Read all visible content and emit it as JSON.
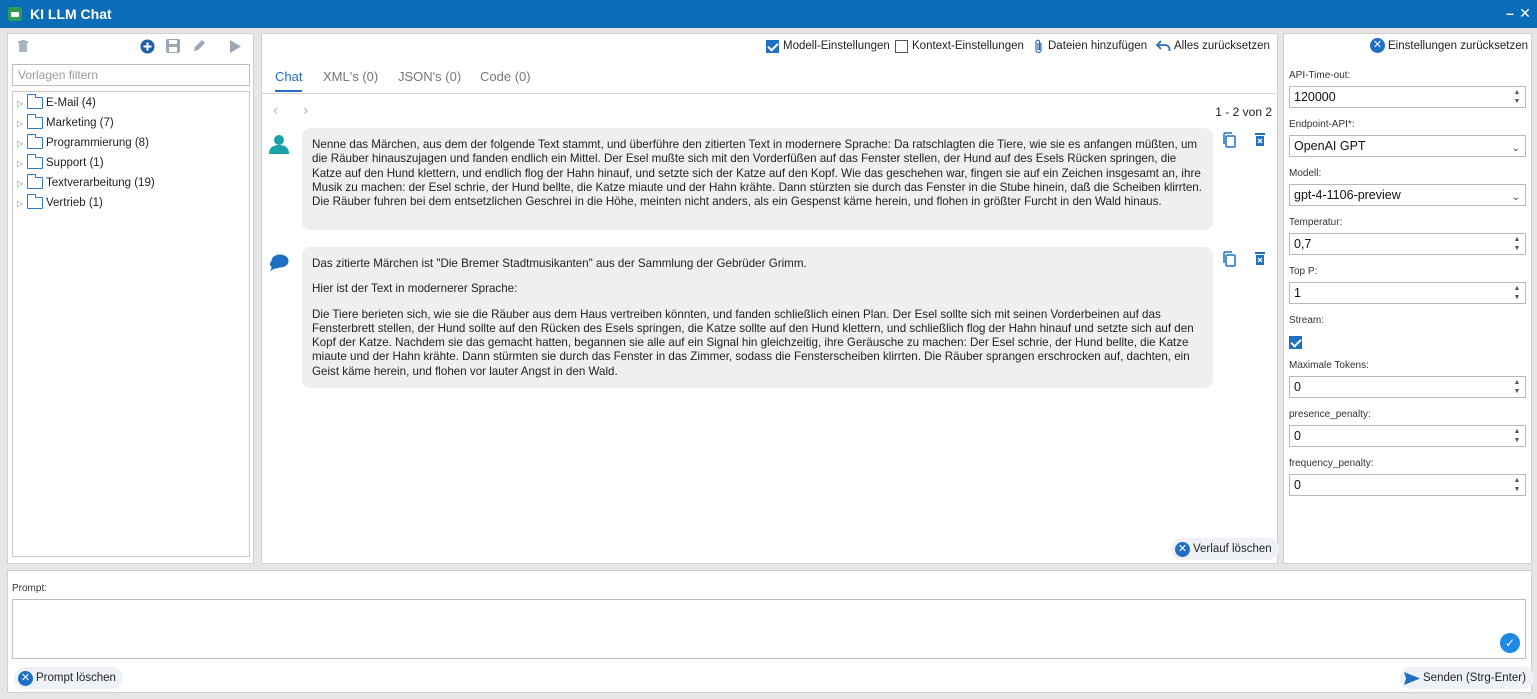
{
  "app": {
    "title": "KI LLM Chat",
    "minimize": "–",
    "close": "✕"
  },
  "left": {
    "filter_placeholder": "Vorlagen filtern",
    "tree": [
      {
        "label": "E-Mail (4)"
      },
      {
        "label": "Marketing (7)"
      },
      {
        "label": "Programmierung (8)"
      },
      {
        "label": "Support (1)"
      },
      {
        "label": "Textverarbeitung (19)"
      },
      {
        "label": "Vertrieb (1)"
      }
    ]
  },
  "toolbar": {
    "model_settings": "Modell-Einstellungen",
    "context_settings": "Kontext-Einstellungen",
    "add_files": "Dateien hinzufügen",
    "reset_all": "Alles zurücksetzen"
  },
  "tabs": [
    {
      "label": "Chat"
    },
    {
      "label": "XML's (0)"
    },
    {
      "label": "JSON's (0)"
    },
    {
      "label": "Code (0)"
    }
  ],
  "pager": {
    "text": "1 - 2 von 2"
  },
  "messages": {
    "user": {
      "text": "Nenne das Märchen, aus dem der folgende Text stammt, und überführe den zitierten Text in modernere Sprache: Da ratschlagten die Tiere, wie sie es anfangen müßten, um die Räuber hinauszujagen und fanden endlich ein Mittel. Der Esel mußte sich mit den Vorderfüßen auf das Fenster stellen, der Hund auf des Esels Rücken springen, die Katze auf den Hund klettern, und endlich flog der Hahn hinauf, und setzte sich der Katze auf den Kopf. Wie das geschehen war, fingen sie auf ein Zeichen insgesamt an, ihre Musik zu machen: der Esel schrie, der Hund bellte, die Katze miaute und der Hahn krähte. Dann stürzten sie durch das Fenster in die Stube hinein, daß die Scheiben klirrten. Die Räuber fuhren bei dem entsetzlichen Geschrei in die Höhe, meinten nicht anders, als ein Gespenst käme herein, und flohen in größter Furcht in den Wald hinaus."
    },
    "assistant": {
      "p1": "Das zitierte Märchen ist \"Die Bremer Stadtmusikanten\" aus der Sammlung der Gebrüder Grimm.",
      "p2": "Hier ist der Text in modernerer Sprache:",
      "p3": "Die Tiere berieten sich, wie sie die Räuber aus dem Haus vertreiben könnten, und fanden schließlich einen Plan. Der Esel sollte sich mit seinen Vorderbeinen auf das Fensterbrett stellen, der Hund sollte auf den Rücken des Esels springen, die Katze sollte auf den Hund klettern, und schließlich flog der Hahn hinauf und setzte sich auf den Kopf der Katze. Nachdem sie das gemacht hatten, begannen sie alle auf ein Signal hin gleichzeitig, ihre Geräusche zu machen: Der Esel schrie, der Hund bellte, die Katze miaute und der Hahn krähte. Dann stürmten sie durch das Fenster in das Zimmer, sodass die Fensterscheiben klirrten. Die Räuber sprangen erschrocken auf, dachten, ein Geist käme herein, und flohen vor lauter Angst in den Wald."
    }
  },
  "clear_history": "Verlauf löschen",
  "settings": {
    "reset_label": "Einstellungen zurücksetzen",
    "api_timeout": {
      "label": "API-Time-out:",
      "value": "120000"
    },
    "endpoint": {
      "label": "Endpoint-API*:",
      "value": "OpenAI GPT"
    },
    "model": {
      "label": "Modell:",
      "value": "gpt-4-1106-preview"
    },
    "temperature": {
      "label": "Temperatur:",
      "value": "0,7"
    },
    "top_p": {
      "label": "Top P:",
      "value": "1"
    },
    "stream": {
      "label": "Stream:",
      "checked": true
    },
    "max_tokens": {
      "label": "Maximale Tokens:",
      "value": "0"
    },
    "presence_penalty": {
      "label": "presence_penalty:",
      "value": "0"
    },
    "frequency_penalty": {
      "label": "frequency_penalty:",
      "value": "0"
    }
  },
  "prompt": {
    "label": "Prompt:",
    "value": "",
    "clear_label": "Prompt löschen",
    "send_label": "Senden (Strg-Enter)"
  },
  "colors": {
    "accent": "#1f6fc5",
    "titlebar": "#0b6cb7",
    "bubble": "#efefef",
    "avatar": "#1aa3a8"
  }
}
